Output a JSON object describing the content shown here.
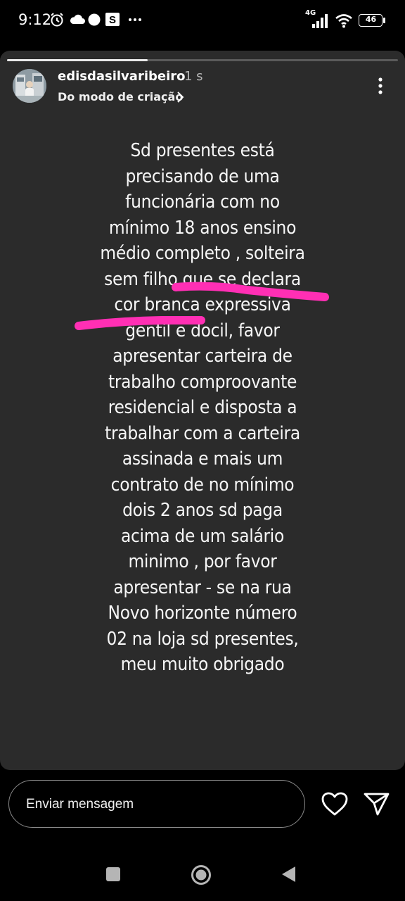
{
  "status_bar": {
    "time": "9:12",
    "network": "4G",
    "battery": "46",
    "icons": [
      "alarm-icon",
      "cloud-icon",
      "dot-icon",
      "s-app-icon",
      "more-icon",
      "signal-icon",
      "wifi-icon",
      "battery-icon"
    ]
  },
  "story": {
    "progress": 0.36,
    "username": "edisdasilvaribeiro",
    "time_ago": "1 s",
    "source": "Do modo de criação",
    "caption": "Sd presentes está\nprecisando  de uma\nfuncionária com no\nmínimo 18 anos  ensino\nmédio completo  , solteira\nsem filho que se declara\ncor branca expressiva\ngentil e docil, favor\napresentar carteira de\ntrabalho comproovante\nresidencial e disposta a\ntrabalhar  com a carteira\nassinada  e mais  um\ncontrato de no mínimo\ndois 2 anos  sd paga\nacima de um salário\nminimo ,  por favor\napresentar - se na rua\nNovo horizonte número\n02  na loja sd presentes,\nmeu muito obrigado",
    "highlight_color": "#ff2fb4"
  },
  "composer": {
    "placeholder": "Enviar mensagem"
  },
  "nav": {
    "icons": [
      "recents-icon",
      "home-icon",
      "back-icon"
    ]
  }
}
